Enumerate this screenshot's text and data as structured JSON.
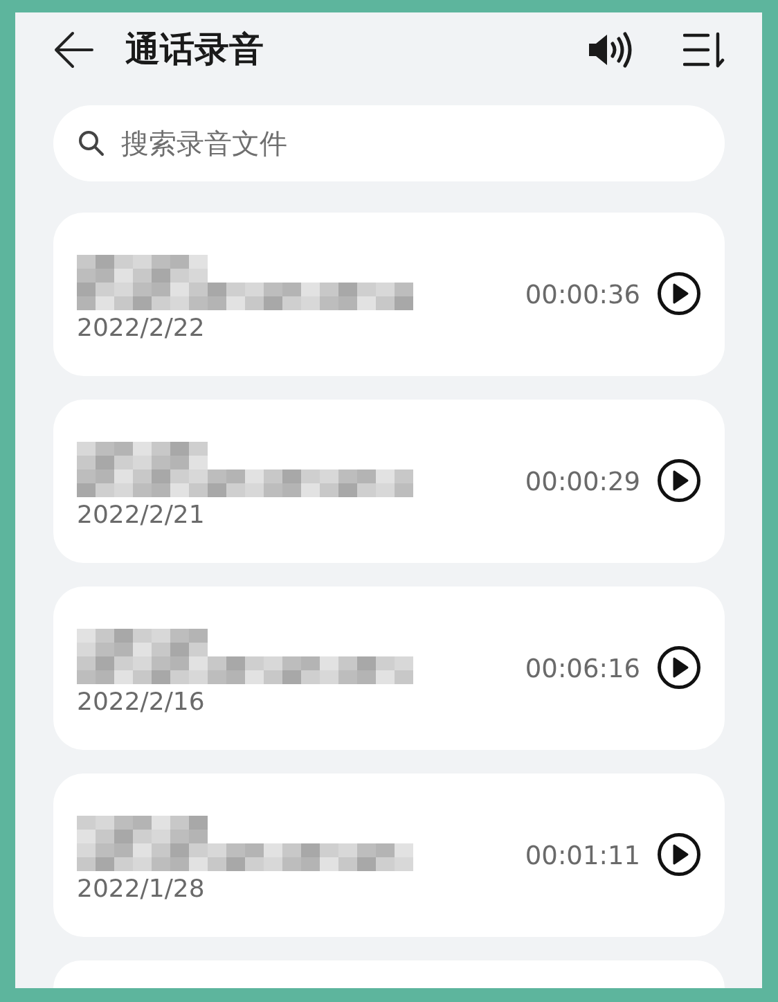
{
  "header": {
    "title": "通话录音"
  },
  "search": {
    "placeholder": "搜索录音文件"
  },
  "recordings": [
    {
      "date": "2022/2/22",
      "duration": "00:00:36"
    },
    {
      "date": "2022/2/21",
      "duration": "00:00:29"
    },
    {
      "date": "2022/2/16",
      "duration": "00:06:16"
    },
    {
      "date": "2022/1/28",
      "duration": "00:01:11"
    }
  ]
}
